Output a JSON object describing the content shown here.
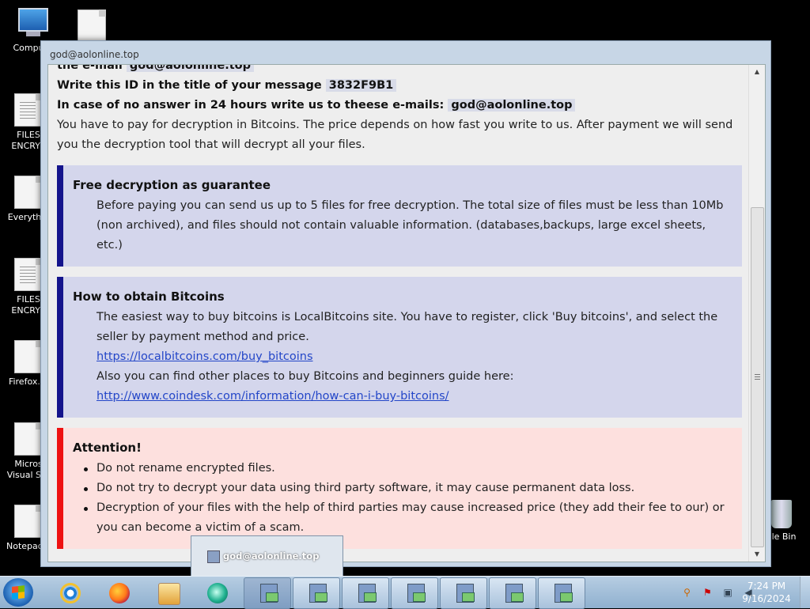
{
  "desktop": {
    "icons": [
      {
        "label": "Compu"
      },
      {
        "label": ""
      },
      {
        "label": "FILES ENCRYP"
      },
      {
        "label": "Everythin"
      },
      {
        "label": "FILES ENCRYP"
      },
      {
        "label": "Firefox.In"
      },
      {
        "label": "Micros Visual Stu"
      },
      {
        "label": "Notepad+"
      },
      {
        "label": "cle Bin"
      }
    ]
  },
  "window": {
    "title": "god@aolonline.top",
    "line1_text": "the e-mail",
    "line1_email": "god@aolonline.top",
    "line2_text": "Write this ID in the title of your message",
    "line2_id": "3832F9B1",
    "line3_text": "In case of no answer in 24 hours write us to theese e-mails:",
    "line3_email": "god@aolonline.top",
    "intro": "You have to pay for decryption in Bitcoins. The price depends on how fast you write to us. After payment we will send you the decryption tool that will decrypt all your files.",
    "free": {
      "title": "Free decryption as guarantee",
      "text": "Before paying you can send us up to 5 files for free decryption. The total size of files must be less than 10Mb (non archived), and files should not contain valuable information. (databases,backups, large excel sheets, etc.)"
    },
    "bitcoins": {
      "title": "How to obtain Bitcoins",
      "text1": "The easiest way to buy bitcoins is LocalBitcoins site. You have to register, click 'Buy bitcoins', and select the seller by payment method and price.",
      "link1": "https://localbitcoins.com/buy_bitcoins",
      "text2": "Also you can find other places to buy Bitcoins and beginners guide here:",
      "link2": "http://www.coindesk.com/information/how-can-i-buy-bitcoins/"
    },
    "attention": {
      "title": "Attention!",
      "items": [
        "Do not rename encrypted files.",
        "Do not try to decrypt your data using third party software, it may cause permanent data loss.",
        "Decryption of your files with the help of third parties may cause increased price (they add their fee to our) or you can become a victim of a scam."
      ]
    }
  },
  "taskbar": {
    "preview_label": "god@aolonline.top",
    "time": "7:24 PM",
    "date": "9/16/2024"
  }
}
